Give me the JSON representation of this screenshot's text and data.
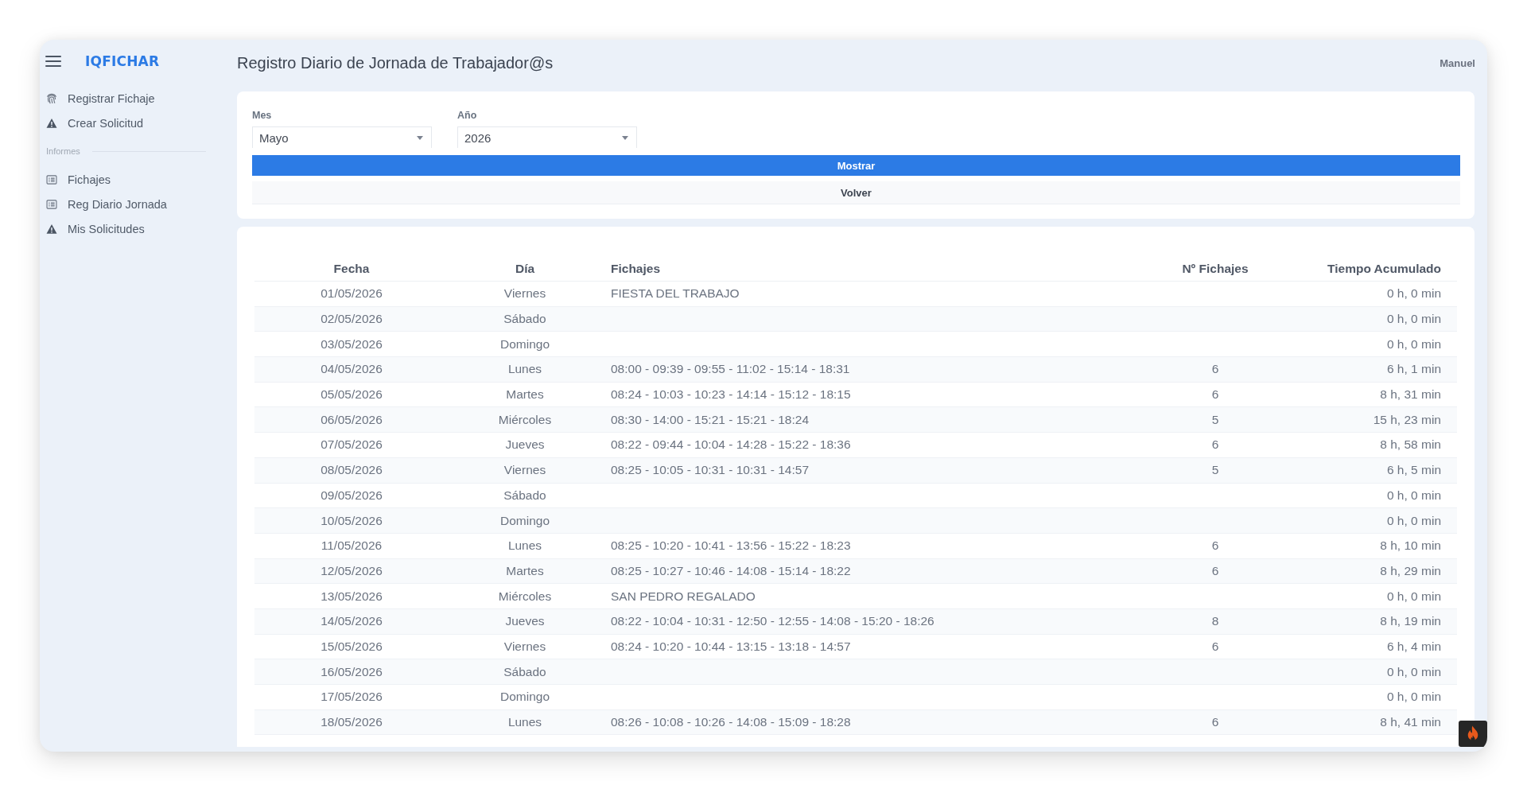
{
  "sidebar": {
    "logo": "IQFICHAR",
    "items": [
      {
        "label": "Registrar Fichaje",
        "kind": "punch"
      },
      {
        "label": "Crear Solicitud",
        "kind": "request"
      }
    ],
    "sections": [
      {
        "title": "Informes",
        "items": [
          {
            "label": "Fichajes",
            "kind": "report"
          },
          {
            "label": "Reg Diario Jornada",
            "kind": "report"
          },
          {
            "label": "Mis Solicitudes",
            "kind": "request"
          }
        ]
      }
    ]
  },
  "header": {
    "title": "Registro Diario de Jornada de Trabajador@s",
    "user": "Manuel"
  },
  "filters": {
    "fields": [
      {
        "label": "Mes",
        "value": "Mayo"
      },
      {
        "label": "Año",
        "value": "2026"
      }
    ],
    "buttons": [
      {
        "label": "Mostrar",
        "kind": "primary"
      },
      {
        "label": "Volver",
        "kind": "secondary"
      }
    ]
  },
  "table": {
    "columns": [
      "Fecha",
      "Día",
      "Fichajes",
      "Nº Fichajes",
      "Tiempo Acumulado"
    ],
    "rows": [
      {
        "date": "01/05/2026",
        "weekday": "Viernes",
        "punches": "FIESTA DEL TRABAJO",
        "accumulated_time": "0 h, 0 min"
      },
      {
        "date": "02/05/2026",
        "weekday": "Sábado",
        "accumulated_time": "0 h, 0 min"
      },
      {
        "date": "03/05/2026",
        "weekday": "Domingo",
        "accumulated_time": "0 h, 0 min"
      },
      {
        "date": "04/05/2026",
        "weekday": "Lunes",
        "punches": "08:00 - 09:39 - 09:55 - 11:02 - 15:14 - 18:31",
        "punch_count": "6",
        "accumulated_time": "6 h, 1 min"
      },
      {
        "date": "05/05/2026",
        "weekday": "Martes",
        "punches": "08:24 - 10:03 - 10:23 - 14:14 - 15:12 - 18:15",
        "punch_count": "6",
        "accumulated_time": "8 h, 31 min"
      },
      {
        "date": "06/05/2026",
        "weekday": "Miércoles",
        "punches": "08:30 - 14:00 - 15:21 - 15:21 - 18:24",
        "punch_count": "5",
        "accumulated_time": "15 h, 23 min"
      },
      {
        "date": "07/05/2026",
        "weekday": "Jueves",
        "punches": "08:22 - 09:44 - 10:04 - 14:28 - 15:22 - 18:36",
        "punch_count": "6",
        "accumulated_time": "8 h, 58 min"
      },
      {
        "date": "08/05/2026",
        "weekday": "Viernes",
        "punches": "08:25 - 10:05 - 10:31 - 10:31 - 14:57",
        "punch_count": "5",
        "accumulated_time": "6 h, 5 min"
      },
      {
        "date": "09/05/2026",
        "weekday": "Sábado",
        "accumulated_time": "0 h, 0 min"
      },
      {
        "date": "10/05/2026",
        "weekday": "Domingo",
        "accumulated_time": "0 h, 0 min"
      },
      {
        "date": "11/05/2026",
        "weekday": "Lunes",
        "punches": "08:25 - 10:20 - 10:41 - 13:56 - 15:22 - 18:23",
        "punch_count": "6",
        "accumulated_time": "8 h, 10 min"
      },
      {
        "date": "12/05/2026",
        "weekday": "Martes",
        "punches": "08:25 - 10:27 - 10:46 - 14:08 - 15:14 - 18:22",
        "punch_count": "6",
        "accumulated_time": "8 h, 29 min"
      },
      {
        "date": "13/05/2026",
        "weekday": "Miércoles",
        "punches": "SAN PEDRO REGALADO",
        "accumulated_time": "0 h, 0 min"
      },
      {
        "date": "14/05/2026",
        "weekday": "Jueves",
        "punches": "08:22 - 10:04 - 10:31 - 12:50 - 12:55 - 14:08 - 15:20 - 18:26",
        "punch_count": "8",
        "accumulated_time": "8 h, 19 min"
      },
      {
        "date": "15/05/2026",
        "weekday": "Viernes",
        "punches": "08:24 - 10:20 - 10:44 - 13:15 - 13:18 - 14:57",
        "punch_count": "6",
        "accumulated_time": "6 h, 4 min"
      },
      {
        "date": "16/05/2026",
        "weekday": "Sábado",
        "accumulated_time": "0 h, 0 min"
      },
      {
        "date": "17/05/2026",
        "weekday": "Domingo",
        "accumulated_time": "0 h, 0 min"
      },
      {
        "date": "18/05/2026",
        "weekday": "Lunes",
        "punches": "08:26 - 10:08 - 10:26 - 14:08 - 15:09 - 18:28",
        "punch_count": "6",
        "accumulated_time": "8 h, 41 min"
      }
    ]
  }
}
